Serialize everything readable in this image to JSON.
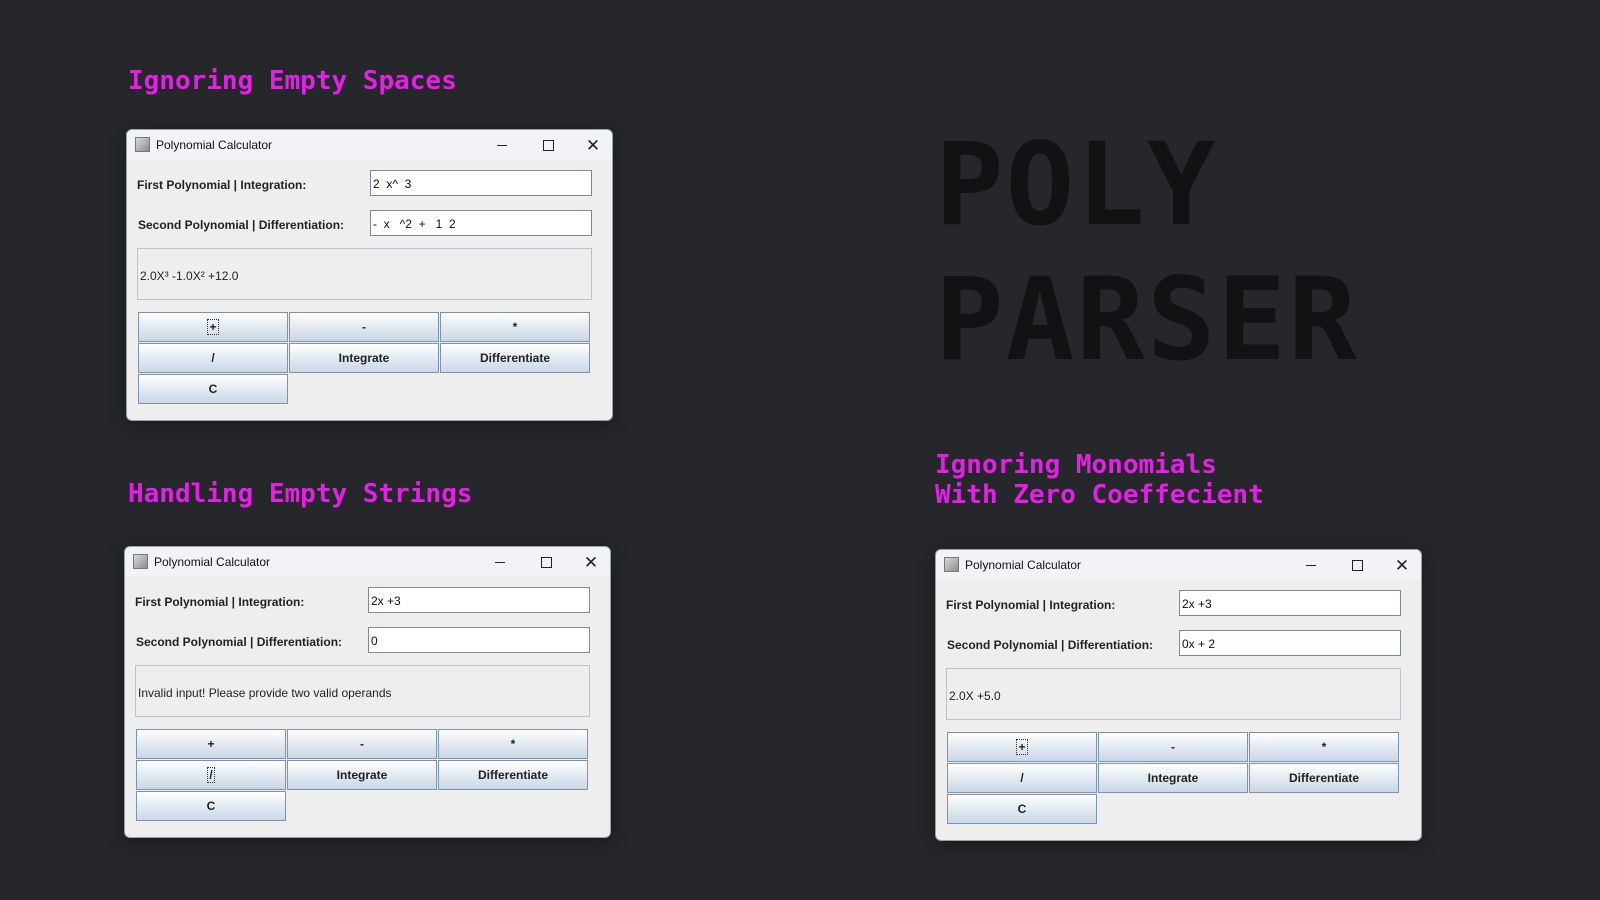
{
  "headings": {
    "spaces": "Ignoring Empty Spaces",
    "empty": "Handling Empty Strings",
    "zero_line1": "Ignoring Monomials",
    "zero_line2": "With Zero Coeffecient"
  },
  "big_title": {
    "line1": "POLY",
    "line2": "PARSER"
  },
  "windows": [
    {
      "title": "Polynomial Calculator",
      "first_label": "First Polynomial | Integration:",
      "second_label": "Second Polynomial | Differentiation:",
      "first_value": "2  x^  3",
      "second_value": "-  x   ^2  +   1  2",
      "result": "2.0X³ -1.0X² +12.0",
      "buttons": [
        "+",
        "-",
        "*",
        "/",
        "Integrate",
        "Differentiate",
        "C"
      ]
    },
    {
      "title": "Polynomial Calculator",
      "first_label": "First Polynomial | Integration:",
      "second_label": "Second Polynomial | Differentiation:",
      "first_value": "2x +3",
      "second_value": "0",
      "result": "Invalid input! Please provide two valid operands",
      "buttons": [
        "+",
        "-",
        "*",
        "/",
        "Integrate",
        "Differentiate",
        "C"
      ]
    },
    {
      "title": "Polynomial Calculator",
      "first_label": "First Polynomial | Integration:",
      "second_label": "Second Polynomial | Differentiation:",
      "first_value": "2x +3",
      "second_value": "0x + 2",
      "result": "2.0X +5.0",
      "buttons": [
        "+",
        "-",
        "*",
        "/",
        "Integrate",
        "Differentiate",
        "C"
      ]
    }
  ],
  "icons": {
    "app": "java-app-icon",
    "minimize": "minimize-icon",
    "maximize": "maximize-icon",
    "close": "close-icon"
  }
}
